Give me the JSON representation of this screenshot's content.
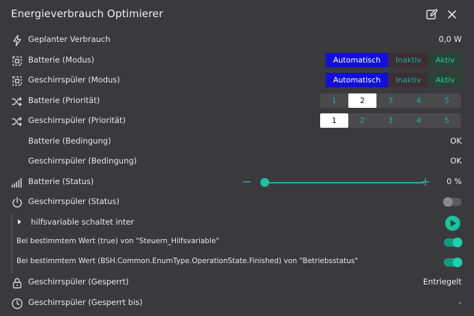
{
  "dialog": {
    "title": "Energieverbrauch Optimierer",
    "edit_icon": "pencil-square-icon",
    "close_icon": "close-icon"
  },
  "rows": {
    "planned": {
      "label": "Geplanter Verbrauch",
      "value": "0,0 W",
      "icon": "lightning-icon"
    },
    "battery_mode": {
      "label": "Batterie (Modus)",
      "icon": "mode-icon"
    },
    "dishwasher_mode": {
      "label": "Geschirrspüler (Modus)",
      "icon": "mode-icon"
    },
    "battery_priority": {
      "label": "Batterie (Priorität)",
      "icon": "shuffle-icon",
      "selected": "2"
    },
    "dishwasher_priority": {
      "label": "Geschirrspüler (Priorität)",
      "icon": "shuffle-icon",
      "selected": "1"
    },
    "battery_condition": {
      "label": "Batterie (Bedingung)",
      "value": "OK"
    },
    "dishwasher_condition": {
      "label": "Geschirrspüler (Bedingung)",
      "value": "OK"
    },
    "battery_status": {
      "label": "Batterie (Status)",
      "value": "0 %",
      "level": 0,
      "icon": "signal-bars-icon"
    },
    "dishwasher_status": {
      "label": "Geschirrspüler (Status)",
      "icon": "power-icon",
      "on": false
    },
    "script": {
      "label": "hilfsvariable schaltet inter",
      "icon": "play-icon"
    },
    "trigger1": {
      "label": "Bei bestimmtem Wert (true) von \"Steuern_Hilfsvariable\"",
      "on": true
    },
    "trigger2": {
      "label": "Bei bestimmtem Wert (BSH.Common.EnumType.OperationState.Finished) von \"Betriebsstatus\"",
      "on": true
    },
    "locked": {
      "label": "Geschirrspüler (Gesperrt)",
      "value": "Entriegelt",
      "icon": "lock-icon"
    },
    "locked_until": {
      "label": "Geschirrspüler (Gesperrt bis)",
      "value": "-",
      "icon": "clock-icon"
    }
  },
  "mode_options": [
    "Automatisch",
    "Inaktiv",
    "Aktiv"
  ],
  "priority_options": [
    "1",
    "2",
    "3",
    "4",
    "5"
  ],
  "slider": {
    "minus": "−",
    "plus": "+"
  },
  "colors": {
    "accent": "#17c2a0",
    "auto_selected": "#1010d8",
    "background": "#3a3a3c"
  }
}
